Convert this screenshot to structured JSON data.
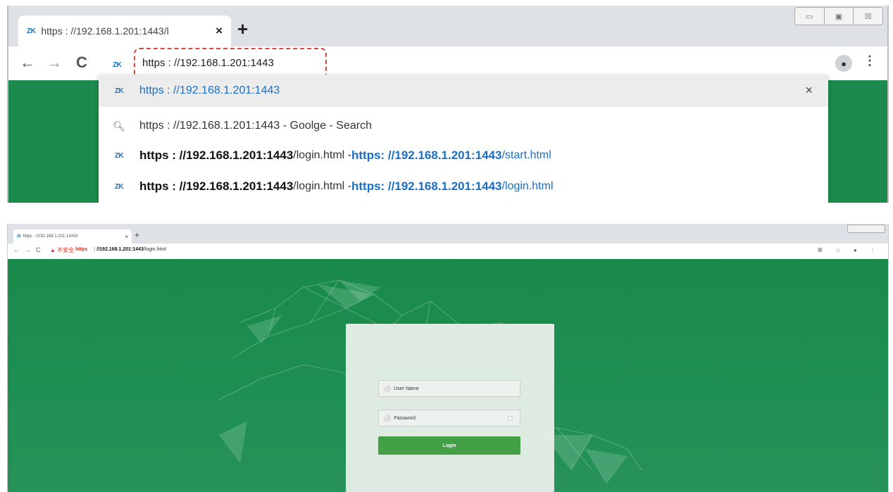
{
  "top": {
    "tab": {
      "favicon": "ZK",
      "title": "https : //192.168.1.201:1443/l",
      "close": "×"
    },
    "new_tab": "+",
    "window_controls": [
      "▭",
      "▣",
      "☒"
    ],
    "nav": {
      "back": "←",
      "forward": "→",
      "reload": "C"
    },
    "omnibox": {
      "favicon": "ZK",
      "value": "https : //192.168.1.201:1443"
    },
    "profile_icon": "person-icon",
    "menu": "⋮",
    "suggestions": [
      {
        "icon": "ZK",
        "text": "https : //192.168.1.201:1443",
        "close": "×"
      },
      {
        "icon": "search-icon",
        "text": "https : //192.168.1.201:1443 - Goolge - Search"
      },
      {
        "icon": "ZK",
        "bold1": "https : //192.168.1.201:1443",
        "plain1": "/login.html - ",
        "bold2": "https",
        "blue2": " : //192.168.1.201:1443",
        "plain2": "/start.html"
      },
      {
        "icon": "ZK",
        "bold1": "https : //192.168.1.201:1443",
        "plain1": "/login.html - ",
        "bold2": "https",
        "blue2": " : //192.168.1.201:1443",
        "plain2": "/login.html"
      }
    ]
  },
  "bottom": {
    "tab": {
      "favicon": "ZK",
      "title": "https : //192.168.1.201:1443/l",
      "close": "×"
    },
    "new_tab": "+",
    "nav": {
      "back": "←",
      "forward": "→",
      "reload": "C"
    },
    "security_warning": "▲ 不安全",
    "url_scheme": "https",
    "url_host": " : //192.168.1.201:1443",
    "url_path": "/login.html",
    "toolbar_right": "⌘ ☆ ● ⋮",
    "login": {
      "username_placeholder": "User Name",
      "password_placeholder": "Password",
      "login_button": "Login"
    },
    "colors": {
      "background": "#1b8a4c",
      "button": "#43a047"
    }
  }
}
